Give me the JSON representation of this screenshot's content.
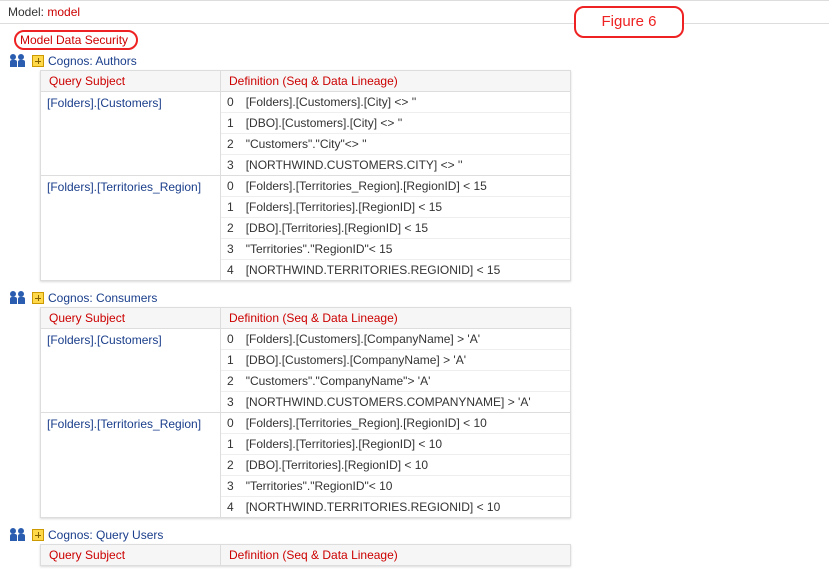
{
  "header": {
    "model_label": "Model:",
    "model_value": "model",
    "figure_label": "Figure 6",
    "section_title": "Model Data Security"
  },
  "columns": {
    "query_subject": "Query Subject",
    "definition": "Definition (Seq & Data Lineage)"
  },
  "groups": [
    {
      "name": "Cognos: Authors",
      "subjects": [
        {
          "name": "[Folders].[Customers]",
          "definitions": [
            "[Folders].[Customers].[City] <> ''",
            "[DBO].[Customers].[City] <> ''",
            "\"Customers\".\"City\"<> ''",
            "[NORTHWIND.CUSTOMERS.CITY] <> ''"
          ]
        },
        {
          "name": "[Folders].[Territories_Region]",
          "definitions": [
            "[Folders].[Territories_Region].[RegionID] < 15",
            "[Folders].[Territories].[RegionID] < 15",
            "[DBO].[Territories].[RegionID] < 15",
            "\"Territories\".\"RegionID\"< 15",
            "[NORTHWIND.TERRITORIES.REGIONID] < 15"
          ]
        }
      ]
    },
    {
      "name": "Cognos: Consumers",
      "subjects": [
        {
          "name": "[Folders].[Customers]",
          "definitions": [
            "[Folders].[Customers].[CompanyName] > 'A'",
            "[DBO].[Customers].[CompanyName] > 'A'",
            "\"Customers\".\"CompanyName\"> 'A'",
            "[NORTHWIND.CUSTOMERS.COMPANYNAME] > 'A'"
          ]
        },
        {
          "name": "[Folders].[Territories_Region]",
          "definitions": [
            "[Folders].[Territories_Region].[RegionID] < 10",
            "[Folders].[Territories].[RegionID] < 10",
            "[DBO].[Territories].[RegionID] < 10",
            "\"Territories\".\"RegionID\"< 10",
            "[NORTHWIND.TERRITORIES.REGIONID] < 10"
          ]
        }
      ]
    },
    {
      "name": "Cognos: Query Users",
      "subjects": []
    }
  ]
}
